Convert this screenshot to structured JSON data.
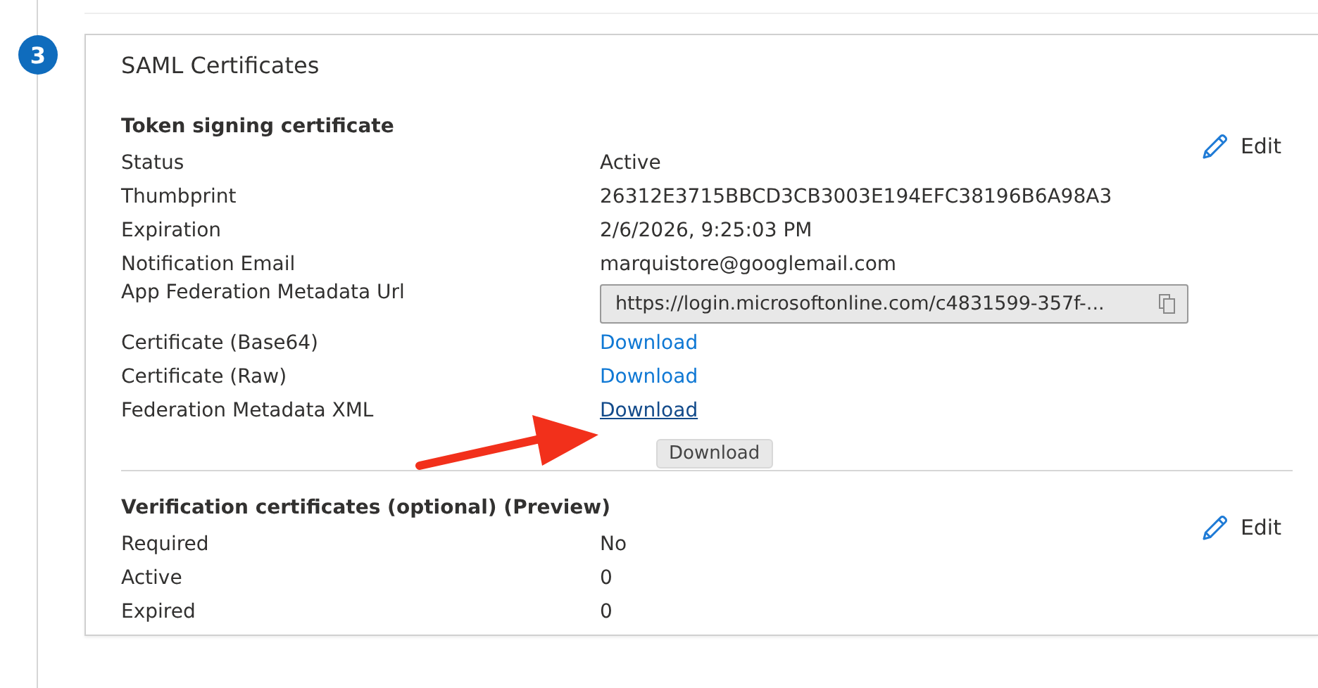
{
  "step_number": "3",
  "card": {
    "title": "SAML Certificates",
    "sections": [
      {
        "heading": "Token signing certificate",
        "edit_label": "Edit",
        "rows": [
          {
            "label": "Status",
            "kind": "text",
            "value": "Active"
          },
          {
            "label": "Thumbprint",
            "kind": "text",
            "value": "26312E3715BBCD3CB3003E194EFC38196B6A98A3"
          },
          {
            "label": "Expiration",
            "kind": "text",
            "value": "2/6/2026, 9:25:03 PM"
          },
          {
            "label": "Notification Email",
            "kind": "text",
            "value": "marquistore@googlemail.com"
          },
          {
            "label": "App Federation Metadata Url",
            "kind": "url",
            "value": "https://login.microsoftonline.com/c4831599-357f-..."
          },
          {
            "label": "Certificate (Base64)",
            "kind": "link",
            "value": "Download",
            "hovered": false
          },
          {
            "label": "Certificate (Raw)",
            "kind": "link",
            "value": "Download",
            "hovered": false
          },
          {
            "label": "Federation Metadata XML",
            "kind": "link",
            "value": "Download",
            "hovered": true,
            "tooltip": "Download"
          }
        ]
      },
      {
        "heading": "Verification certificates (optional) (Preview)",
        "edit_label": "Edit",
        "rows": [
          {
            "label": "Required",
            "kind": "text",
            "value": "No"
          },
          {
            "label": "Active",
            "kind": "text",
            "value": "0"
          },
          {
            "label": "Expired",
            "kind": "text",
            "value": "0"
          }
        ]
      }
    ]
  }
}
